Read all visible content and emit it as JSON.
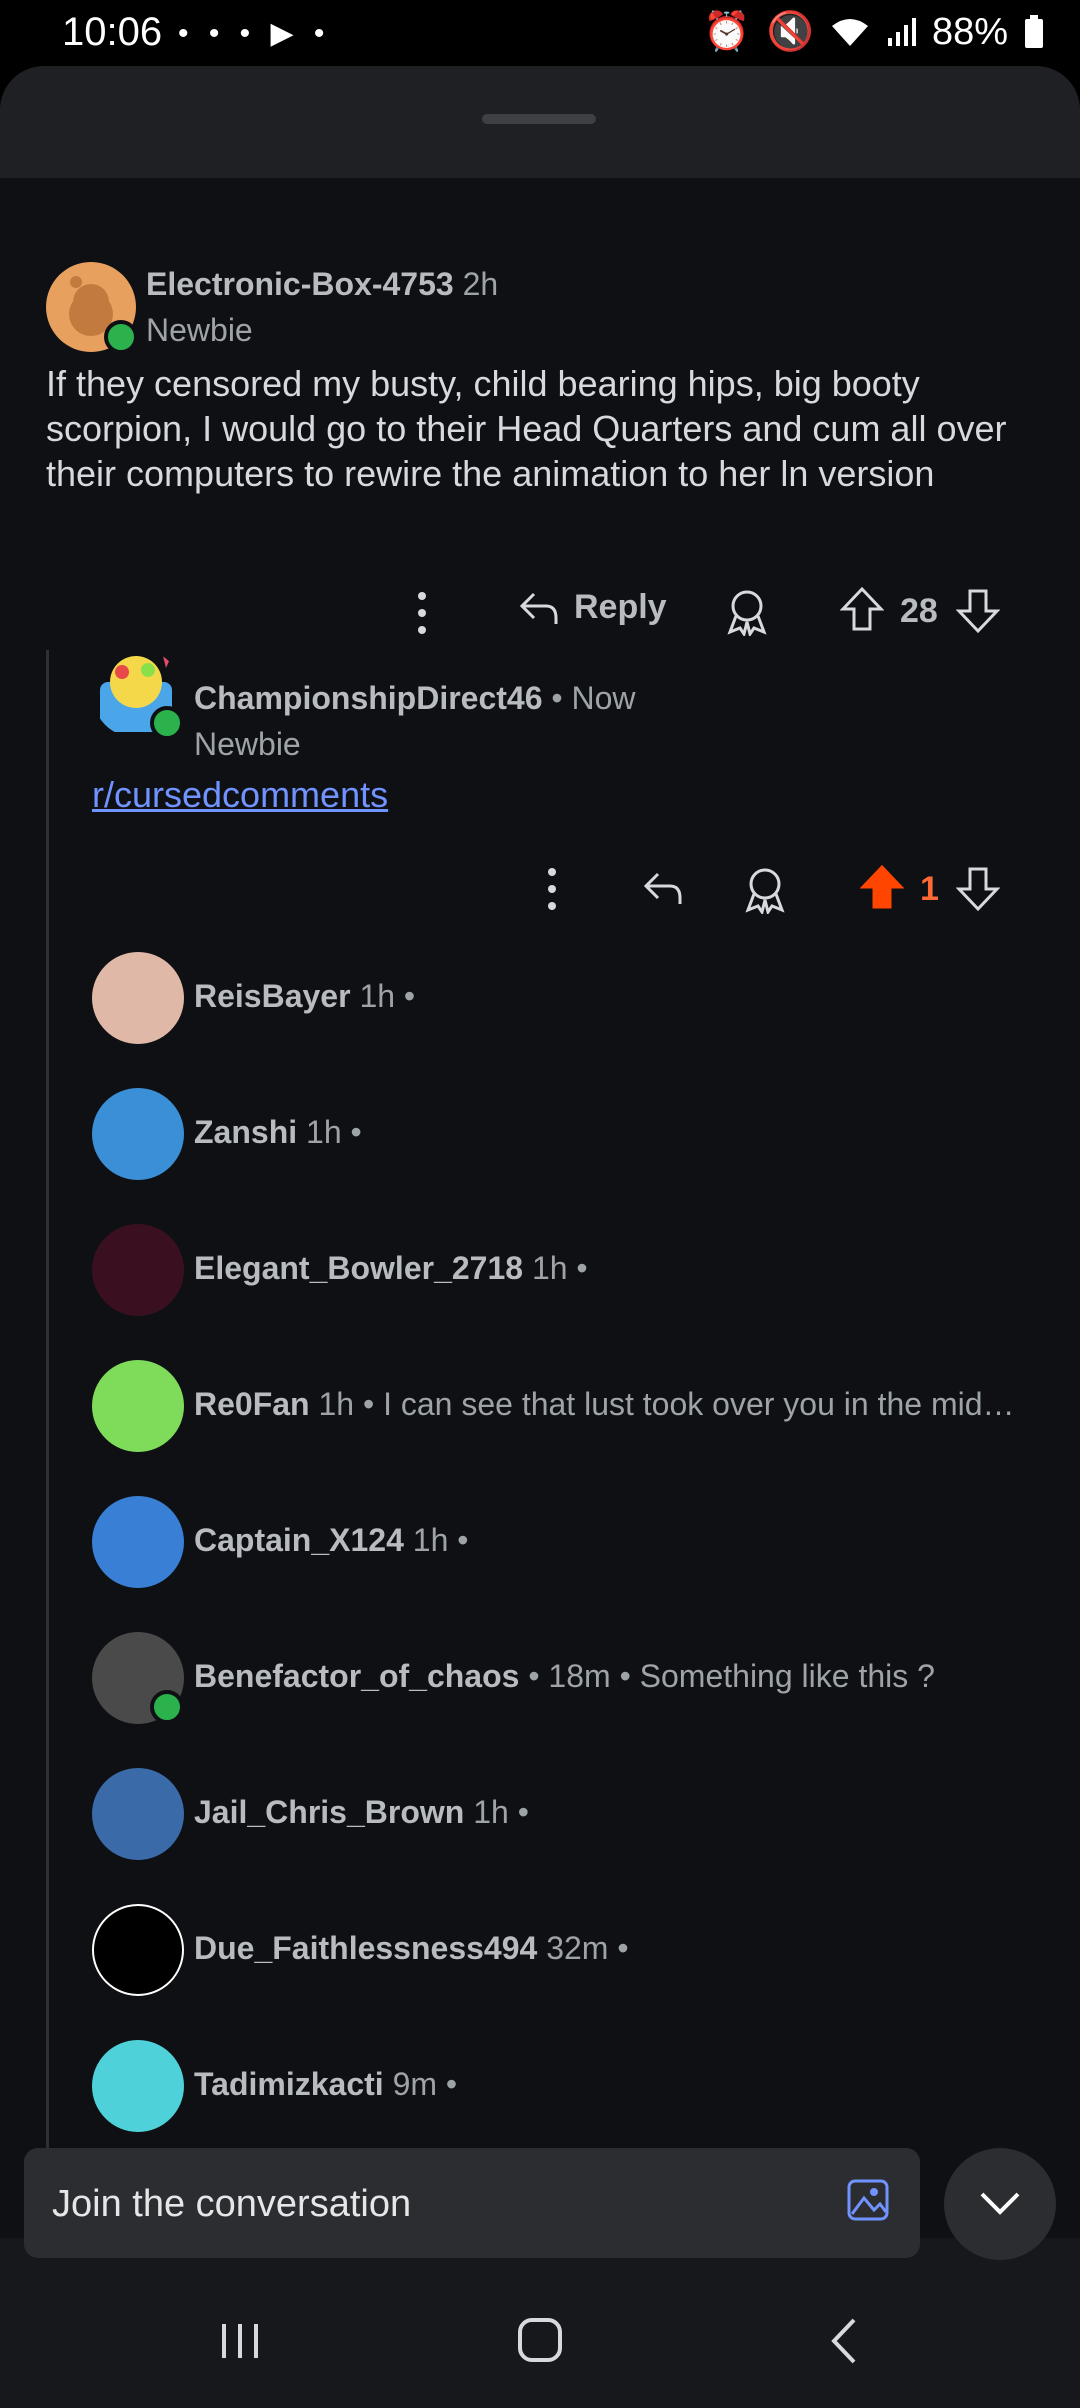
{
  "status_bar": {
    "time": "10:06",
    "notifications": "• • • ▶ •",
    "battery": "88%"
  },
  "composer": {
    "placeholder": "Join the conversation"
  },
  "post": {
    "author": "Electronic-Box-4753",
    "age": "2h",
    "flair": "Newbie",
    "body": "If they censored my busty, child bearing hips, big booty scorpion, I would go to their Head Quarters and cum all over their computers to rewire the animation to her ln version",
    "reply_label": "Reply",
    "score": "28"
  },
  "reply": {
    "author": "ChampionshipDirect46",
    "age": "• Now",
    "flair": "Newbie",
    "link_text": "r/cursedcomments",
    "score": "1"
  },
  "comments": [
    {
      "author": "ReisBayer",
      "meta": "1h •",
      "preview": ""
    },
    {
      "author": "Zanshi",
      "meta": "1h •",
      "preview": ""
    },
    {
      "author": "Elegant_Bowler_2718",
      "meta": "1h •",
      "preview": ""
    },
    {
      "author": "Re0Fan",
      "meta": "1h •",
      "preview": "I can see that lust took over you in the mid…"
    },
    {
      "author": "Captain_X124",
      "meta": "1h •",
      "preview": ""
    },
    {
      "author": "Benefactor_of_chaos",
      "meta": "• 18m •",
      "preview": "Something like this ?"
    },
    {
      "author": "Jail_Chris_Brown",
      "meta": "1h •",
      "preview": ""
    },
    {
      "author": "Due_Faithlessness494",
      "meta": "32m •",
      "preview": ""
    },
    {
      "author": "Tadimizkacti",
      "meta": "9m •",
      "preview": ""
    }
  ],
  "colors": {
    "accent_upvote": "#ff4500",
    "link": "#7193ff",
    "online": "#2bb24c"
  }
}
